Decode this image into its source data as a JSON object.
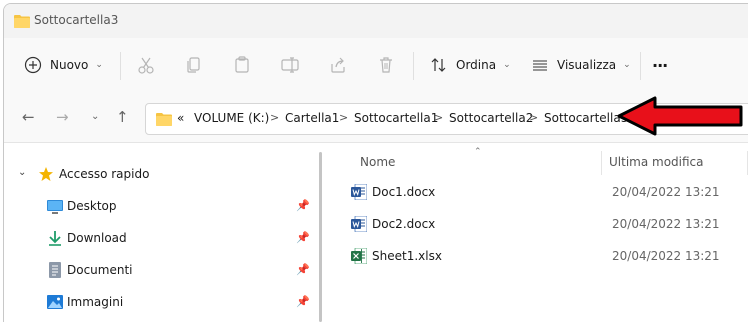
{
  "window": {
    "title": "Sottocartella3"
  },
  "toolbar": {
    "new_label": "Nuovo",
    "sort_label": "Ordina",
    "view_label": "Visualizza",
    "more_label": "···"
  },
  "address": {
    "overflow": "«",
    "crumbs": [
      "VOLUME (K:)",
      "Cartella1",
      "Sottocartella1",
      "Sottocartella2",
      "Sottocartella3"
    ],
    "separator": ">"
  },
  "sidebar": {
    "items": [
      {
        "label": "Accesso rapido",
        "icon": "star-icon",
        "pinned": false
      },
      {
        "label": "Desktop",
        "icon": "desktop-icon",
        "pinned": true
      },
      {
        "label": "Download",
        "icon": "download-arrow-icon",
        "pinned": true
      },
      {
        "label": "Documenti",
        "icon": "document-icon",
        "pinned": true
      },
      {
        "label": "Immagini",
        "icon": "image-icon",
        "pinned": true
      }
    ]
  },
  "files": {
    "columns": {
      "name": "Nome",
      "modified": "Ultima modifica"
    },
    "rows": [
      {
        "name": "Doc1.docx",
        "modified": "20/04/2022 13:21",
        "type": "word"
      },
      {
        "name": "Doc2.docx",
        "modified": "20/04/2022 13:21",
        "type": "word"
      },
      {
        "name": "Sheet1.xlsx",
        "modified": "20/04/2022 13:21",
        "type": "excel"
      }
    ]
  },
  "colors": {
    "annotation_arrow": "#e8101a",
    "folder": "#f6c443",
    "word": "#2b579a",
    "excel": "#217346",
    "star": "#f4b400"
  }
}
